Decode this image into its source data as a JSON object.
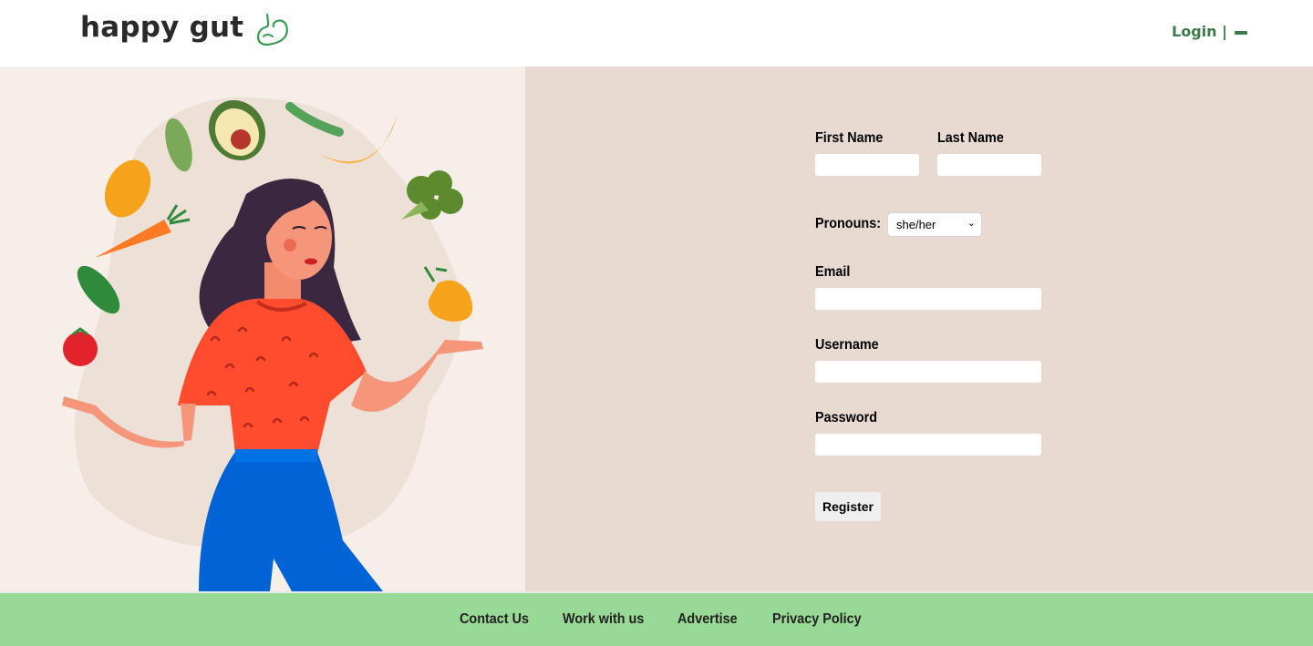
{
  "header": {
    "brand": "happy gut",
    "logo_icon": "stomach-icon",
    "login_label": "Login |",
    "menu_icon": "minus-icon",
    "accent_color": "#3b7a4a"
  },
  "illustration": {
    "subject": "woman-juggling-fruits-and-vegetables"
  },
  "form": {
    "first_name_label": "First Name",
    "last_name_label": "Last Name",
    "pronouns_label": "Pronouns:",
    "pronouns_value": "she/her",
    "email_label": "Email",
    "username_label": "Username",
    "password_label": "Password",
    "register_label": "Register",
    "first_name_value": "",
    "last_name_value": "",
    "email_value": "",
    "username_value": "",
    "password_value": ""
  },
  "footer": {
    "links": [
      "Contact Us",
      "Work with us",
      "Advertise",
      "Privacy Policy"
    ],
    "background": "#99d996"
  }
}
